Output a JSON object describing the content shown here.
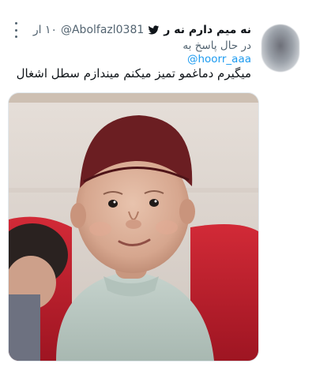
{
  "tweet": {
    "display_name": "نه میم دارم نه ر",
    "handle": "@Abolfazl0381",
    "time": "۱۰ ار",
    "reply_prefix": "در حال پاسخ به",
    "reply_to": "@hoorr_aaa",
    "text": "میگیرم دماغمو تمیز میکنم میندازم سطل اشغال"
  },
  "icons": {
    "verified_or_bird": "bird-icon",
    "more": "more-icon",
    "avatar": "avatar"
  },
  "colors": {
    "link": "#1d9bf0",
    "secondary_text": "#536471",
    "primary_text": "#0f1419",
    "couch_red": "#c21d2b",
    "cap_maroon": "#6b1e22"
  }
}
